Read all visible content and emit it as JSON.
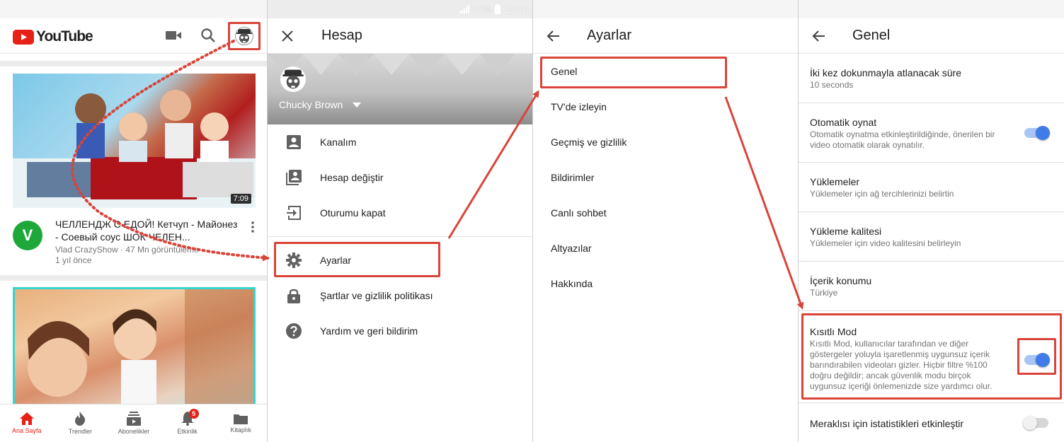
{
  "status_bar": {
    "battery": "33%",
    "time": "19:16"
  },
  "panel_home": {
    "logo_text": "YouTube",
    "video1": {
      "duration": "7:09",
      "title": "ЧЕЛЛЕНДЖ С ЕДОЙ! Кетчуп - Майонез - Соевый соус ШОК ЧЕЛЕН...",
      "channel_initial": "V",
      "meta_line1": "Vlad CrazyShow · 47 Mn görüntüleme",
      "meta_line2": "1 yıl önce"
    },
    "bottom_nav": [
      {
        "label": "Ana Sayfa",
        "icon": "home-icon"
      },
      {
        "label": "Trendler",
        "icon": "flame-icon"
      },
      {
        "label": "Abonelikler",
        "icon": "subscriptions-icon"
      },
      {
        "label": "Etkinlik",
        "icon": "bell-icon",
        "badge": "5"
      },
      {
        "label": "Kitaplık",
        "icon": "folder-icon"
      }
    ]
  },
  "panel_account": {
    "title": "Hesap",
    "user_name": "Chucky Brown",
    "menu": [
      {
        "label": "Kanalım",
        "icon": "person-box-icon"
      },
      {
        "label": "Hesap değiştir",
        "icon": "switch-account-icon"
      },
      {
        "label": "Oturumu kapat",
        "icon": "sign-out-icon"
      },
      {
        "label": "Ayarlar",
        "icon": "gear-icon"
      },
      {
        "label": "Şartlar ve gizlilik politikası",
        "icon": "lock-icon"
      },
      {
        "label": "Yardım ve geri bildirim",
        "icon": "help-icon"
      }
    ]
  },
  "panel_settings": {
    "title": "Ayarlar",
    "items": [
      "Genel",
      "TV'de izleyin",
      "Geçmiş ve gizlilik",
      "Bildirimler",
      "Canlı sohbet",
      "Altyazılar",
      "Hakkında"
    ]
  },
  "panel_general": {
    "title": "Genel",
    "items": [
      {
        "title": "İki kez dokunmayla atlanacak süre",
        "subtitle": "10 seconds"
      },
      {
        "title": "Otomatik oynat",
        "subtitle": "Otomatik oynatma etkinleştirildiğinde, önerilen bir video otomatik olarak oynatılır.",
        "toggle": "on"
      },
      {
        "title": "Yüklemeler",
        "subtitle": "Yüklemeler için ağ tercihlerinizi belirtin"
      },
      {
        "title": "Yükleme kalitesi",
        "subtitle": "Yüklemeler için video kalitesini belirleyin"
      },
      {
        "title": "İçerik konumu",
        "subtitle": "Türkiye"
      },
      {
        "title": "Kısıtlı Mod",
        "subtitle": "Kısıtlı Mod, kullanıcılar tarafından ve diğer göstergeler yoluyla işaretlenmiş uygunsuz içerik barındırabilen videoları gizler. Hiçbir filtre %100 doğru değildir; ancak güvenlik modu birçok uygunsuz içeriği önlemenizde size yardımcı olur.",
        "toggle": "on"
      },
      {
        "title": "Meraklısı için istatistikleri etkinleştir",
        "subtitle": "",
        "toggle": "off"
      }
    ]
  },
  "colors": {
    "highlight": "#d9443a",
    "youtube_red": "#e62117",
    "toggle_on": "#3f7ce8"
  }
}
